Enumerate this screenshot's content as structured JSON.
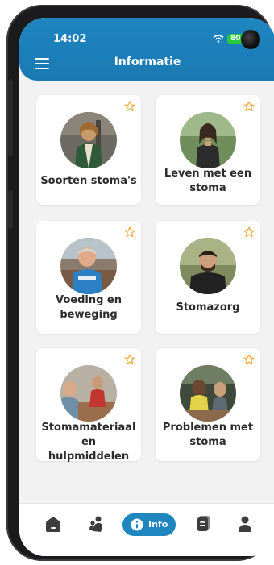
{
  "status_bar": {
    "time": "14:02",
    "battery": "80"
  },
  "header": {
    "title": "Informatie"
  },
  "cards": [
    {
      "label_lines": [
        "Soorten stoma's",
        ""
      ]
    },
    {
      "label_lines": [
        "Leven met een",
        "stoma"
      ]
    },
    {
      "label_lines": [
        "Voeding en",
        "beweging"
      ]
    },
    {
      "label_lines": [
        "Stomazorg",
        ""
      ]
    },
    {
      "label_lines": [
        "Stomamateriaal",
        "en hulpmiddelen"
      ]
    },
    {
      "label_lines": [
        "Problemen met",
        "stoma"
      ]
    }
  ],
  "bottom_nav": {
    "active_label": "Info",
    "items": [
      "home-icon",
      "people-icon",
      "info-icon",
      "documents-icon",
      "profile-icon"
    ]
  },
  "colors": {
    "brand": "#1f86c0",
    "star": "#f2a93b",
    "background": "#f2f2f3"
  }
}
